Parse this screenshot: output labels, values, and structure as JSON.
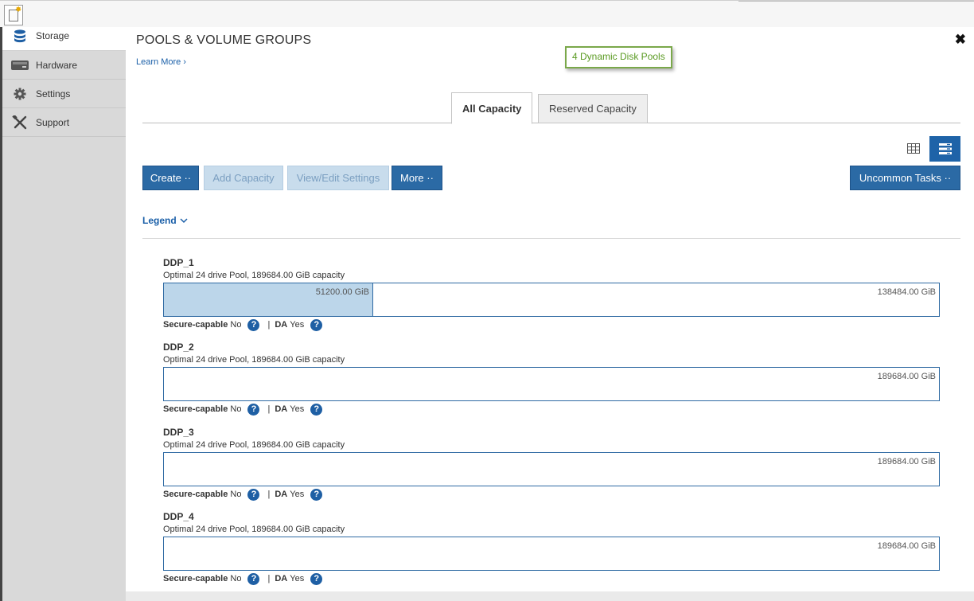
{
  "sidebar": {
    "items": [
      {
        "label": "Storage",
        "icon": "database-icon",
        "active": true
      },
      {
        "label": "Hardware",
        "icon": "drive-icon",
        "active": false
      },
      {
        "label": "Settings",
        "icon": "gear-icon",
        "active": false
      },
      {
        "label": "Support",
        "icon": "tools-icon",
        "active": false
      }
    ]
  },
  "header": {
    "title": "POOLS & VOLUME GROUPS",
    "learn_more": "Learn More ›",
    "close_glyph": "✖",
    "tooltip": "4 Dynamic Disk Pools"
  },
  "tabs": [
    {
      "label": "All Capacity",
      "active": true
    },
    {
      "label": "Reserved Capacity",
      "active": false
    }
  ],
  "toolbar": {
    "create": "Create ··",
    "add_capacity": "Add Capacity",
    "view_edit": "View/Edit Settings",
    "more": "More ··",
    "uncommon": "Uncommon Tasks ··"
  },
  "legend": {
    "label": "Legend"
  },
  "pools": [
    {
      "name": "DDP_1",
      "description": "Optimal 24 drive Pool, 189684.00 GiB capacity",
      "used_label": "51200.00 GiB",
      "used_fraction": 0.27,
      "free_label": "138484.00 GiB",
      "secure_label": "Secure-capable",
      "secure_value": "No",
      "da_label": "DA",
      "da_value": "Yes",
      "sep": "|"
    },
    {
      "name": "DDP_2",
      "description": "Optimal 24 drive Pool, 189684.00 GiB capacity",
      "used_label": "",
      "used_fraction": 0,
      "free_label": "189684.00 GiB",
      "secure_label": "Secure-capable",
      "secure_value": "No",
      "da_label": "DA",
      "da_value": "Yes",
      "sep": "|"
    },
    {
      "name": "DDP_3",
      "description": "Optimal 24 drive Pool, 189684.00 GiB capacity",
      "used_label": "",
      "used_fraction": 0,
      "free_label": "189684.00 GiB",
      "secure_label": "Secure-capable",
      "secure_value": "No",
      "da_label": "DA",
      "da_value": "Yes",
      "sep": "|"
    },
    {
      "name": "DDP_4",
      "description": "Optimal 24 drive Pool, 189684.00 GiB capacity",
      "used_label": "",
      "used_fraction": 0,
      "free_label": "189684.00 GiB",
      "secure_label": "Secure-capable",
      "secure_value": "No",
      "da_label": "DA",
      "da_value": "Yes",
      "sep": "|"
    }
  ],
  "colors": {
    "accent": "#2b6aa5",
    "tooltip_border": "#7aa84a",
    "used_fill": "#bcd6ea"
  }
}
